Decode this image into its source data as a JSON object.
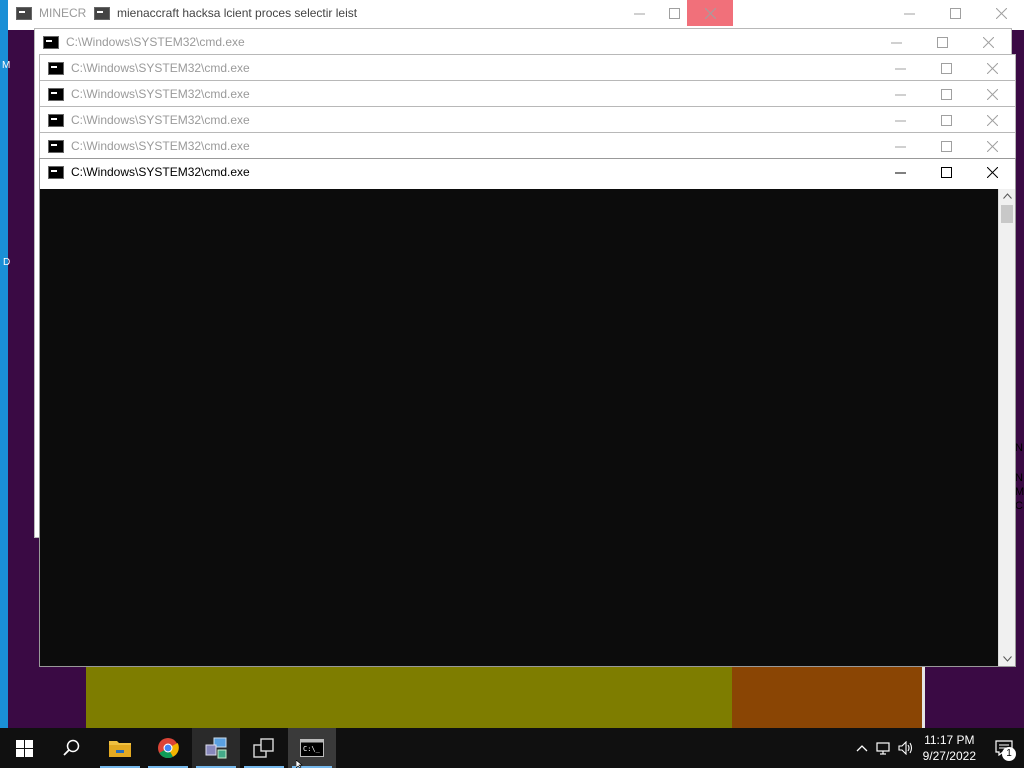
{
  "background_windows": {
    "minecraft_title": "MINECRA",
    "hacks_title": "mienaccraft hacksa lcient proces selectir leist"
  },
  "cmd_windows": [
    {
      "title": "C:\\Windows\\SYSTEM32\\cmd.exe",
      "active": false
    },
    {
      "title": "C:\\Windows\\SYSTEM32\\cmd.exe",
      "active": false
    },
    {
      "title": "C:\\Windows\\SYSTEM32\\cmd.exe",
      "active": false
    },
    {
      "title": "C:\\Windows\\SYSTEM32\\cmd.exe",
      "active": false
    },
    {
      "title": "C:\\Windows\\SYSTEM32\\cmd.exe",
      "active": false
    },
    {
      "title": "C:\\Windows\\SYSTEM32\\cmd.exe",
      "active": true
    }
  ],
  "side_text": {
    "left_top": "M",
    "left_mid": "D",
    "right_lines": [
      "N",
      "N",
      "M",
      "CR"
    ]
  },
  "taskbar": {
    "apps": [
      {
        "name": "start",
        "icon": "windows-start-icon"
      },
      {
        "name": "search",
        "icon": "search-icon"
      },
      {
        "name": "file-explorer",
        "icon": "folder-icon"
      },
      {
        "name": "chrome",
        "icon": "chrome-icon"
      },
      {
        "name": "network-tool",
        "icon": "network-computer-icon"
      },
      {
        "name": "task-view",
        "icon": "task-view-icon"
      },
      {
        "name": "cmd",
        "icon": "console-icon"
      }
    ],
    "clock_time": "11:17 PM",
    "clock_date": "9/27/2022",
    "notification_count": "1"
  },
  "colors": {
    "desktop_blue": "#1a8fd6",
    "console_black": "#0c0c0c",
    "taskbar": "#101010",
    "close_hover": "#f1707a"
  }
}
